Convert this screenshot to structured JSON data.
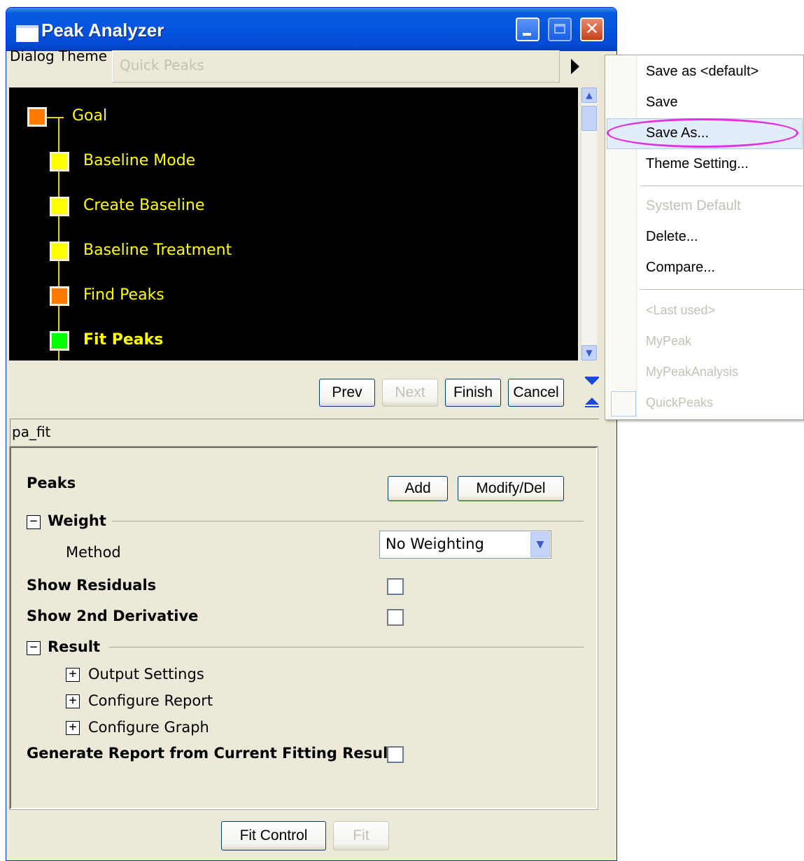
{
  "window": {
    "title": "Peak Analyzer"
  },
  "theme": {
    "label": "Dialog Theme",
    "value": "Quick Peaks"
  },
  "tree": {
    "nodes": [
      {
        "label": "Goal",
        "status": "orange"
      },
      {
        "label": "Baseline Mode",
        "status": "yellow"
      },
      {
        "label": "Create Baseline",
        "status": "yellow"
      },
      {
        "label": "Baseline Treatment",
        "status": "yellow"
      },
      {
        "label": "Find Peaks",
        "status": "orange"
      },
      {
        "label": "Fit Peaks",
        "status": "green",
        "current": true
      }
    ]
  },
  "nav": {
    "prev": "Prev",
    "next": "Next",
    "finish": "Finish",
    "cancel": "Cancel"
  },
  "function_name": "pa_fit",
  "settings": {
    "peaks_label": "Peaks",
    "add_label": "Add",
    "modify_label": "Modify/Del",
    "weight_label": "Weight",
    "method_label": "Method",
    "method_value": "No Weighting",
    "show_residuals_label": "Show Residuals",
    "show_2nd_derivative_label": "Show 2nd Derivative",
    "result_label": "Result",
    "output_settings_label": "Output Settings",
    "configure_report_label": "Configure Report",
    "configure_graph_label": "Configure Graph",
    "generate_report_label": "Generate Report from Current Fitting Result"
  },
  "bottom": {
    "fit_control": "Fit Control",
    "fit": "Fit"
  },
  "menu": {
    "save_default": "Save as <default>",
    "save": "Save",
    "save_as": "Save As...",
    "theme_setting": "Theme Setting...",
    "system_default": "System Default",
    "delete": "Delete...",
    "compare": "Compare...",
    "last_used": "<Last used>",
    "my_peak": "MyPeak",
    "my_peak_analysis": "MyPeakAnalysis",
    "quick_peaks": "QuickPeaks"
  },
  "colors": {
    "node_orange": "#ff7a00",
    "node_yellow": "#ffff00",
    "node_green": "#00ff00",
    "highlight_ellipse": "#e032e0"
  }
}
